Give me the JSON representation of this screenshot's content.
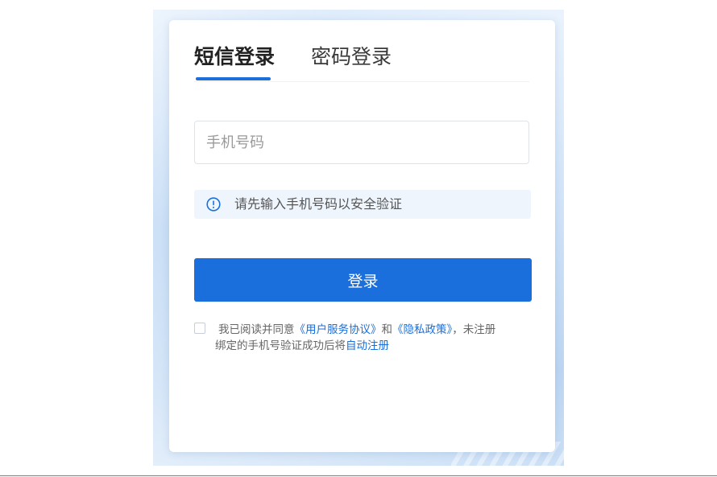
{
  "tabs": {
    "sms_login": "短信登录",
    "password_login": "密码登录"
  },
  "phone_input": {
    "placeholder": "手机号码",
    "value": ""
  },
  "notice": {
    "icon": "info-circle-icon",
    "text": "请先输入手机号码以安全验证"
  },
  "login_button": {
    "label": "登录"
  },
  "agreement": {
    "checked": false,
    "prefix": "我已阅读并同意",
    "service_link": "《用户服务协议》",
    "and": "和",
    "privacy_link": "《隐私政策》",
    "suffix": "，未注册",
    "line2_prefix": "绑定的手机号验证成功后将",
    "auto_register_link": "自动注册"
  },
  "colors": {
    "accent": "#1a6fdc",
    "notice_bg": "#eef5fd"
  }
}
